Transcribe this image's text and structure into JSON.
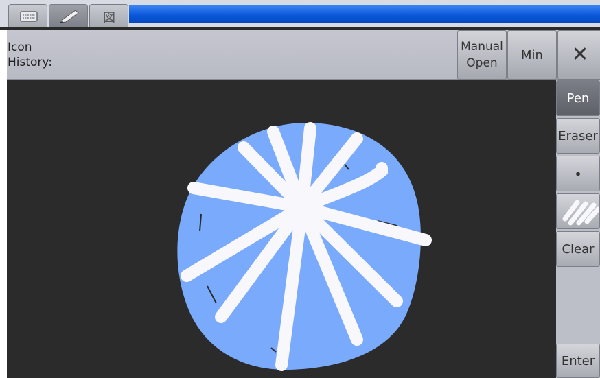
{
  "tabs": [
    {
      "icon": "keyboard-icon"
    },
    {
      "icon": "pencil-icon"
    },
    {
      "icon": "hanzi-character-icon",
      "glyph": "図"
    }
  ],
  "header": {
    "icon_history_label": "Icon\nHistory:",
    "manual_open_label": "Manual\nOpen",
    "min_label": "Min",
    "close_label": "✕"
  },
  "tools": {
    "pen_label": "Pen",
    "eraser_label": "Eraser",
    "small_brush_label": "•",
    "large_brush_icon": "large-brush-icon",
    "clear_label": "Clear",
    "enter_label": "Enter"
  },
  "colors": {
    "titlebar": "#0a57d9",
    "canvas_bg": "#2b2b2b",
    "drawing_fill": "#7aaafb",
    "drawing_stroke": "#f8f8fc"
  }
}
